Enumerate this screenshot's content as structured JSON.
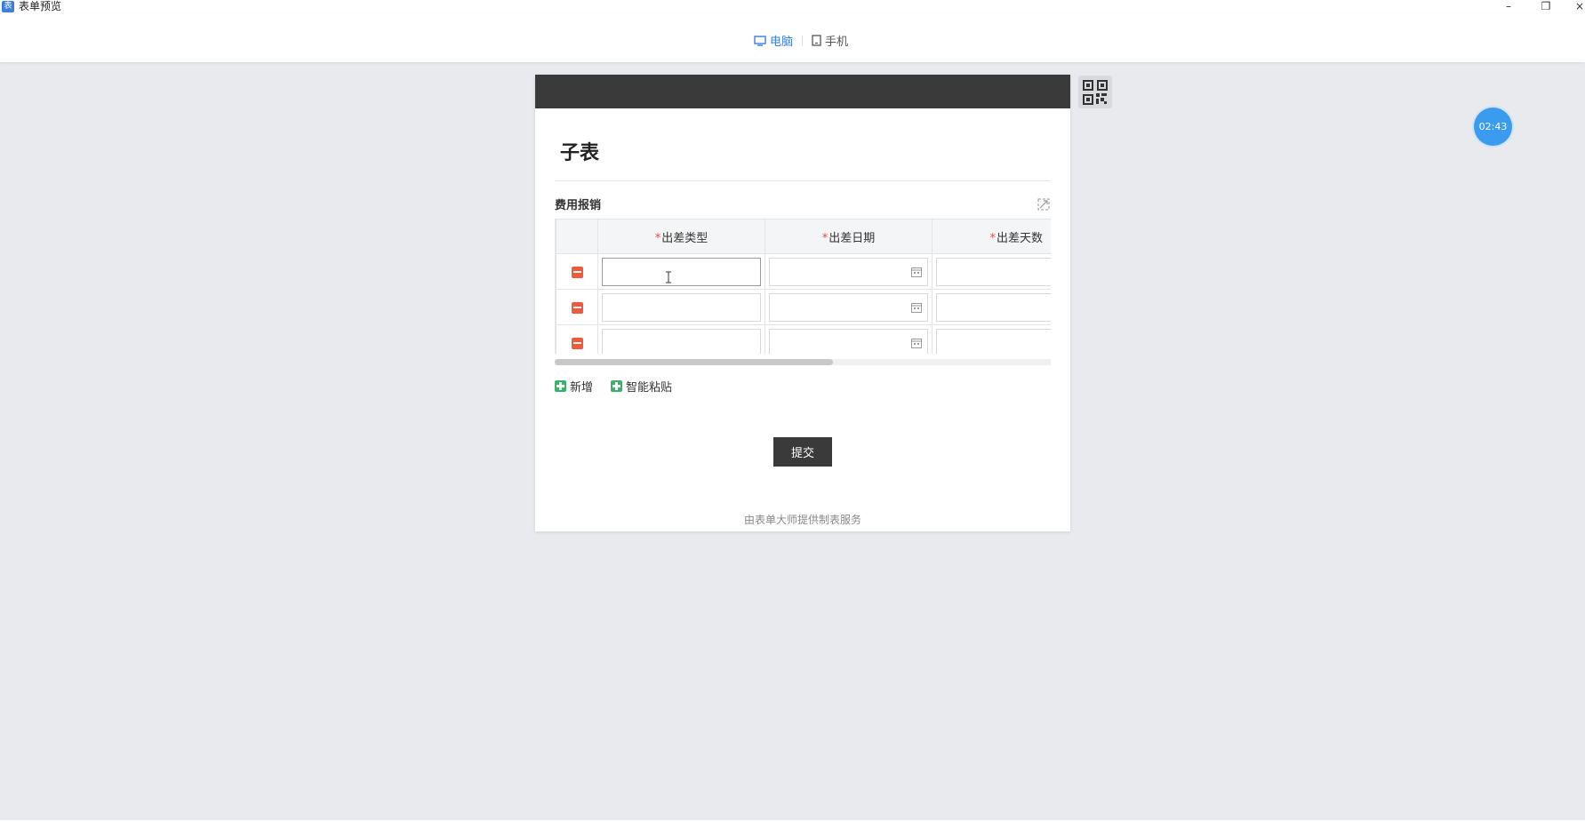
{
  "window": {
    "app_icon_text": "表",
    "title": "表单预览",
    "minimize": "–",
    "restore": "❐",
    "close": "×"
  },
  "device_switch": {
    "desktop_label": "电脑",
    "mobile_label": "手机",
    "active": "desktop"
  },
  "form": {
    "title": "子表",
    "section_title": "费用报销",
    "columns": [
      {
        "label": "出差类型",
        "required": "*"
      },
      {
        "label": "出差日期",
        "required": "*"
      },
      {
        "label": "出差天数",
        "required": "*"
      }
    ],
    "rows": [
      {
        "type": "",
        "date": "",
        "days": ""
      },
      {
        "type": "",
        "date": "",
        "days": ""
      },
      {
        "type": "",
        "date": "",
        "days": ""
      }
    ],
    "add_label": "新增",
    "smart_paste_label": "智能粘贴",
    "submit_label": "提交",
    "footer": "由表单大师提供制表服务"
  },
  "timer": "02:43",
  "colors": {
    "accent": "#3c7de0",
    "header_dark": "#3a3a3a",
    "delete_red": "#f05a3c",
    "add_green": "#3bb26a",
    "timer_blue": "#3a9bef"
  }
}
